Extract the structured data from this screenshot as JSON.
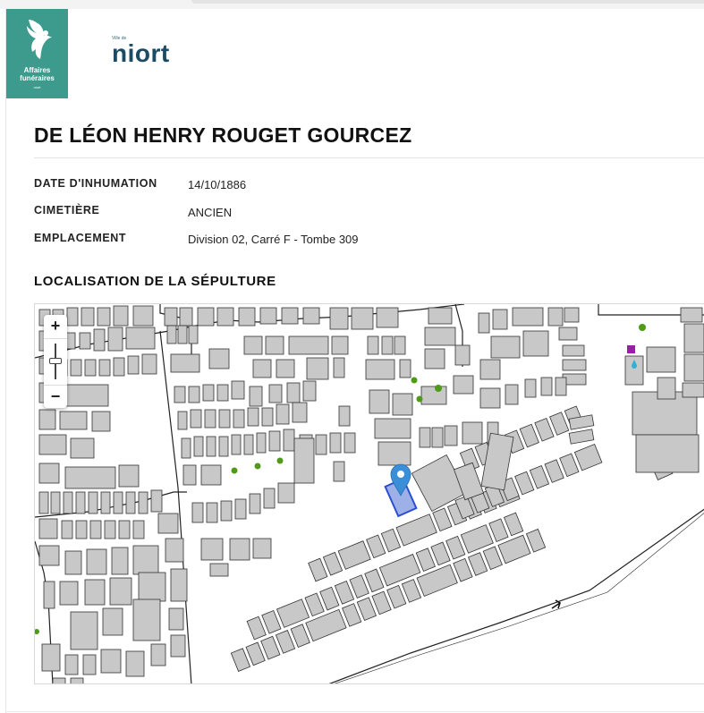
{
  "header": {
    "brand_line1": "Affaires",
    "brand_line2": "funéraires",
    "brand_line3": "niort",
    "brand_icon": "dove-icon",
    "city_small": "Ville de",
    "city_name": "niort",
    "brand_color": "#3c9b8c",
    "city_color": "#1c4b64"
  },
  "record": {
    "title": "DE LÉON HENRY ROUGET GOURCEZ",
    "fields": [
      {
        "label": "DATE D'INHUMATION",
        "value": "14/10/1886"
      },
      {
        "label": "CIMETIÈRE",
        "value": "ANCIEN"
      },
      {
        "label": "EMPLACEMENT",
        "value": "Division 02, Carré F - Tombe 309"
      }
    ]
  },
  "map_section": {
    "title": "LOCALISATION DE LA SÉPULTURE",
    "zoom_in": "+",
    "zoom_out": "−",
    "marker_icon": "map-pin-icon",
    "marker_color": "#3b8fd8",
    "grave_color": "#5b7fd9",
    "tree_color": "#4f9a16"
  }
}
